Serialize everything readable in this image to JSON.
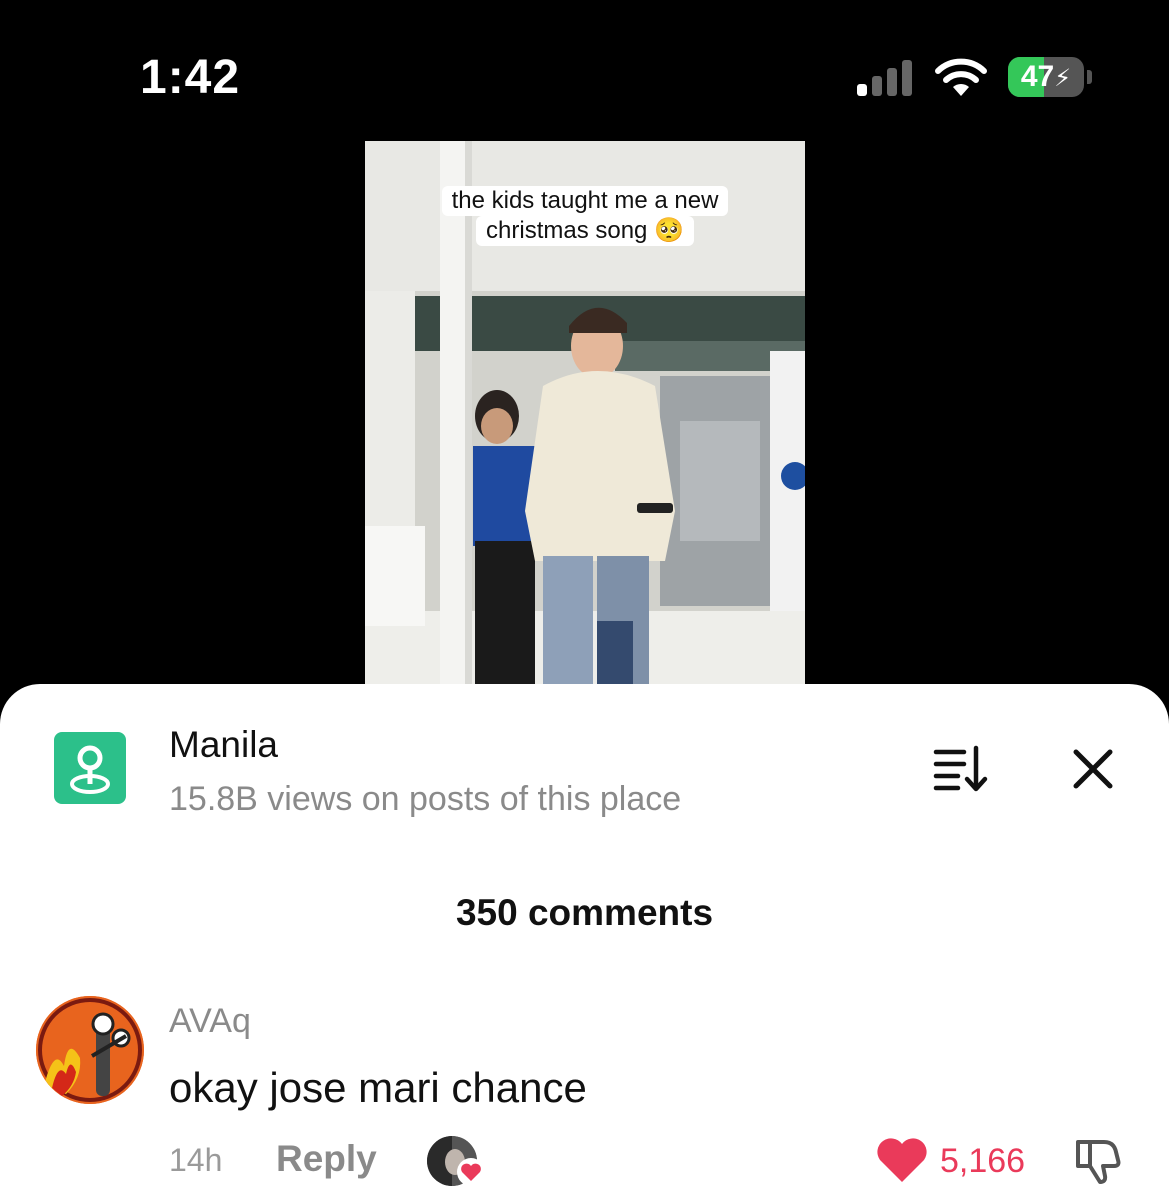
{
  "status_bar": {
    "time": "1:42",
    "battery": "47",
    "battery_level": 0.47,
    "charging": true
  },
  "video": {
    "caption_line1": "the kids taught me a new",
    "caption_line2": "christmas song 🥺"
  },
  "place": {
    "name": "Manila",
    "views": "15.8B views on posts of this place",
    "icon": "location-pin-icon",
    "accent": "#2cc08a"
  },
  "comments": {
    "count_label": "350 comments",
    "items": [
      {
        "username": "AVAq",
        "text": "okay jose mari chance",
        "time": "14h",
        "reply_label": "Reply",
        "likes": "5,166",
        "liked": true
      }
    ]
  },
  "colors": {
    "like": "#ea3a5a",
    "secondary_text": "#8a8a8a"
  }
}
